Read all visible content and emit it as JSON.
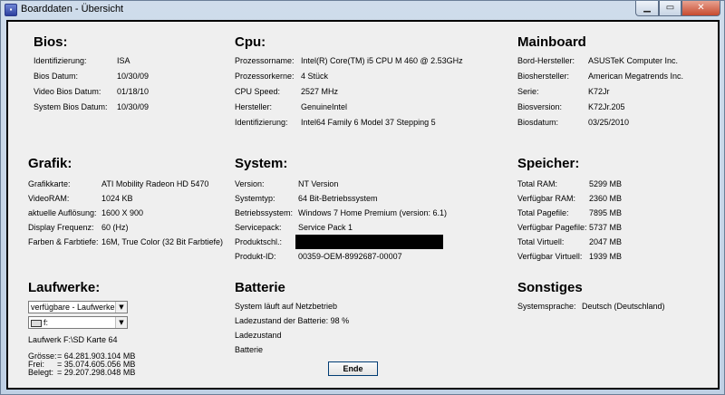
{
  "window": {
    "title": "Boarddaten - Übersicht"
  },
  "bios": {
    "title": "Bios:",
    "rows": [
      {
        "label": "Identifizierung:",
        "value": "ISA"
      },
      {
        "label": "Bios Datum:",
        "value": "10/30/09"
      },
      {
        "label": "Video Bios Datum:",
        "value": "01/18/10"
      },
      {
        "label": "System Bios Datum:",
        "value": "10/30/09"
      }
    ]
  },
  "cpu": {
    "title": "Cpu:",
    "rows": [
      {
        "label": "Prozessorname:",
        "value": "Intel(R) Core(TM) i5 CPU       M 460  @ 2.53GHz"
      },
      {
        "label": "Prozessorkerne:",
        "value": "4 Stück"
      },
      {
        "label": "CPU Speed:",
        "value": "2527 MHz"
      },
      {
        "label": "Hersteller:",
        "value": "GenuineIntel"
      },
      {
        "label": "Identifizierung:",
        "value": "Intel64 Family 6 Model 37 Stepping 5"
      }
    ]
  },
  "mainboard": {
    "title": "Mainboard",
    "rows": [
      {
        "label": "Bord-Hersteller:",
        "value": "ASUSTeK Computer Inc."
      },
      {
        "label": "Bioshersteller:",
        "value": "American Megatrends Inc."
      },
      {
        "label": "Serie:",
        "value": "K72Jr"
      },
      {
        "label": "Biosversion:",
        "value": "K72Jr.205"
      },
      {
        "label": "Biosdatum:",
        "value": "03/25/2010"
      }
    ]
  },
  "grafik": {
    "title": "Grafik:",
    "rows": [
      {
        "label": "Grafikkarte:",
        "value": "ATI Mobility Radeon HD 5470"
      },
      {
        "label": "VideoRAM:",
        "value": "1024 KB"
      },
      {
        "label": "aktuelle Auflösung:",
        "value": "1600  X  900"
      },
      {
        "label": "Display Frequenz:",
        "value": "60 (Hz)"
      },
      {
        "label": "Farben & Farbtiefe:",
        "value": "16M, True Color (32 Bit Farbtiefe)"
      }
    ]
  },
  "system": {
    "title": "System:",
    "rows": [
      {
        "label": "Version:",
        "value": "NT Version"
      },
      {
        "label": "Systemtyp:",
        "value": "64 Bit-Betriebssystem"
      },
      {
        "label": "Betriebssystem:",
        "value": "Windows 7 Home Premium   (version: 6.1)"
      },
      {
        "label": "Servicepack:",
        "value": "Service Pack 1"
      },
      {
        "label": "Produktschl.:",
        "value": ""
      },
      {
        "label": "Produkt-ID:",
        "value": "00359-OEM-8992687-00007"
      }
    ]
  },
  "speicher": {
    "title": "Speicher:",
    "rows": [
      {
        "label": "Total RAM:",
        "value": "5299 MB"
      },
      {
        "label": "Verfügbar RAM:",
        "value": "2360 MB"
      },
      {
        "label": "Total Pagefile:",
        "value": "7895 MB"
      },
      {
        "label": "Verfügbar Pagefile:",
        "value": "5737 MB"
      },
      {
        "label": "Total Virtuell:",
        "value": "2047 MB"
      },
      {
        "label": "Verfügbar Virtuell:",
        "value": "1939 MB"
      }
    ]
  },
  "laufwerke": {
    "title": "Laufwerke:",
    "combo_type": "verfügbare - Laufwerke",
    "combo_drive": "f:",
    "drive_label": "Laufwerk F:\\SD Karte 64",
    "sizes": [
      {
        "label": "Grösse:",
        "value": "= 64.281.903.104 MB"
      },
      {
        "label": "Frei:",
        "value": "= 35.074.605.056 MB"
      },
      {
        "label": "Belegt:",
        "value": "= 29.207.298.048 MB"
      }
    ]
  },
  "batterie": {
    "title": "Batterie",
    "lines": [
      "System läuft auf Netzbetrieb",
      "Ladezustand der Batterie: 98 %",
      "Ladezustand",
      "Batterie"
    ]
  },
  "sonstiges": {
    "title": "Sonstiges",
    "rows": [
      {
        "label": "Systemsprache:",
        "value": "Deutsch (Deutschland)"
      }
    ]
  },
  "buttons": {
    "ende": "Ende"
  }
}
